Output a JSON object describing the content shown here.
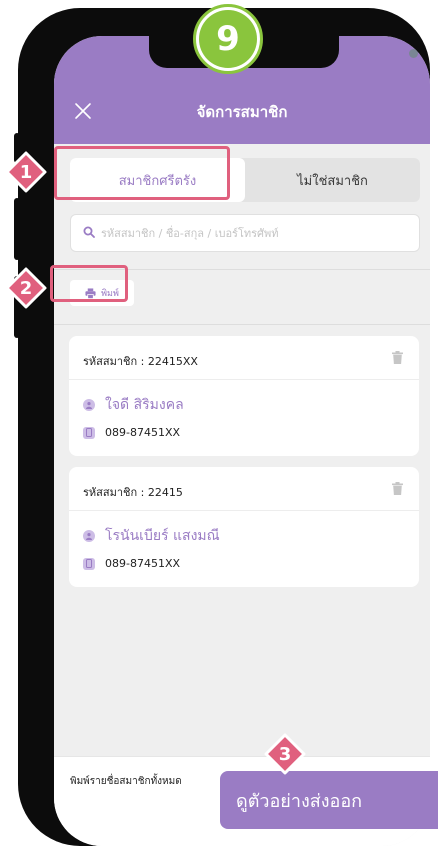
{
  "step_badge": "9",
  "header": {
    "title": "จัดการสมาชิก",
    "close_icon": "close-icon"
  },
  "tabs": [
    {
      "label": "สมาชิกศรีตรัง",
      "active": true
    },
    {
      "label": "ไม่ใช่สมาชิก",
      "active": false
    }
  ],
  "search": {
    "placeholder": "รหัสสมาชิก / ชื่อ-สกุล / เบอร์โทรศัพท์",
    "value": "",
    "icon": "search-icon"
  },
  "print_button": {
    "label": "พิมพ์",
    "icon": "printer-icon"
  },
  "members": [
    {
      "id_label": "รหัสสมาชิก : 22415XX",
      "name": "ใจดี สิริมงคล",
      "phone": "089-87451XX"
    },
    {
      "id_label": "รหัสสมาชิก : 22415",
      "name": "โรนันเบียร์  แสงมณี",
      "phone": "089-87451XX"
    }
  ],
  "bottom_bar": {
    "print_all_label": "พิมพ์รายชื่อสมาชิกทั้งหมด"
  },
  "export_button": {
    "label": "ดูตัวอย่างส่งออก"
  },
  "annotations": {
    "step_1": "1",
    "step_2": "2",
    "step_3": "3"
  },
  "colors": {
    "primary": "#9a7cc4",
    "highlight": "#e0607e",
    "badge": "#8ac53d",
    "background": "#efefef"
  }
}
